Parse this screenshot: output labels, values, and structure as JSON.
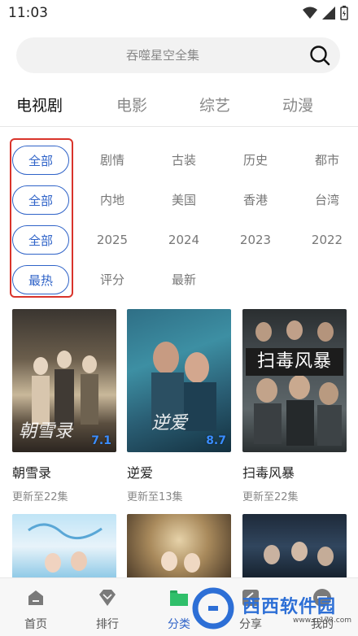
{
  "status_bar": {
    "time": "11:03"
  },
  "search": {
    "placeholder": "吞噬星空全集"
  },
  "tabs": [
    {
      "label": "电视剧",
      "active": true
    },
    {
      "label": "电影",
      "active": false
    },
    {
      "label": "综艺",
      "active": false
    },
    {
      "label": "动漫",
      "active": false
    }
  ],
  "filters": {
    "genre": [
      "全部",
      "剧情",
      "古装",
      "历史",
      "都市"
    ],
    "region": [
      "全部",
      "内地",
      "美国",
      "香港",
      "台湾"
    ],
    "year": [
      "全部",
      "2025",
      "2024",
      "2023",
      "2022"
    ],
    "sort": [
      "最热",
      "评分",
      "最新"
    ]
  },
  "cards": [
    {
      "title": "朝雪录",
      "subtitle": "更新至22集",
      "score": "7.1",
      "poster_text": "朝雪录"
    },
    {
      "title": "逆爱",
      "subtitle": "更新至13集",
      "score": "8.7",
      "poster_text": "逆爱"
    },
    {
      "title": "扫毒风暴",
      "subtitle": "更新至22集",
      "score": "",
      "poster_text": "扫毒风暴"
    }
  ],
  "bottom_nav": [
    {
      "label": "首页",
      "icon": "home-icon"
    },
    {
      "label": "排行",
      "icon": "ranking-icon"
    },
    {
      "label": "分类",
      "icon": "category-icon",
      "active": true
    },
    {
      "label": "分享",
      "icon": "share-icon"
    },
    {
      "label": "我的",
      "icon": "profile-icon"
    }
  ],
  "watermark": {
    "text": "西西软件园",
    "url": "www.cr173.com"
  },
  "colors": {
    "accent": "#2f63c8",
    "highlight": "#d9342b"
  }
}
